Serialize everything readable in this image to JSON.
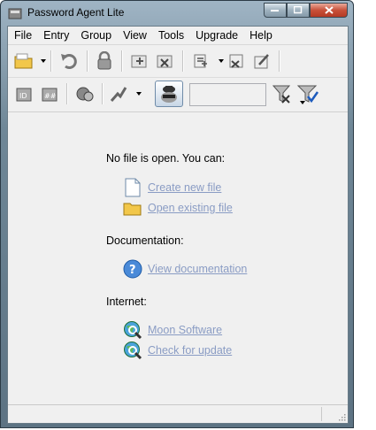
{
  "window": {
    "title": "Password Agent Lite"
  },
  "menu": [
    "File",
    "Entry",
    "Group",
    "View",
    "Tools",
    "Upgrade",
    "Help"
  ],
  "filter": {
    "value": ""
  },
  "content": {
    "intro": "No file is open. You can:",
    "create_new_file": "Create new file",
    "open_existing_file": "Open existing file",
    "documentation_label": "Documentation:",
    "view_documentation": "View documentation",
    "internet_label": "Internet:",
    "moon_software": "Moon Software",
    "check_for_update": "Check for update"
  },
  "icons": [
    "folder-icon",
    "undo-icon",
    "lock-icon",
    "add-group-icon",
    "delete-group-icon",
    "add-entry-icon",
    "delete-entry-icon",
    "edit-entry-icon",
    "copy-username-icon",
    "copy-password-icon",
    "open-url-icon",
    "autotype-icon",
    "reveal-passwords-icon",
    "clear-filter-icon",
    "filter-icon",
    "document-icon",
    "help-icon",
    "globe-icon"
  ]
}
